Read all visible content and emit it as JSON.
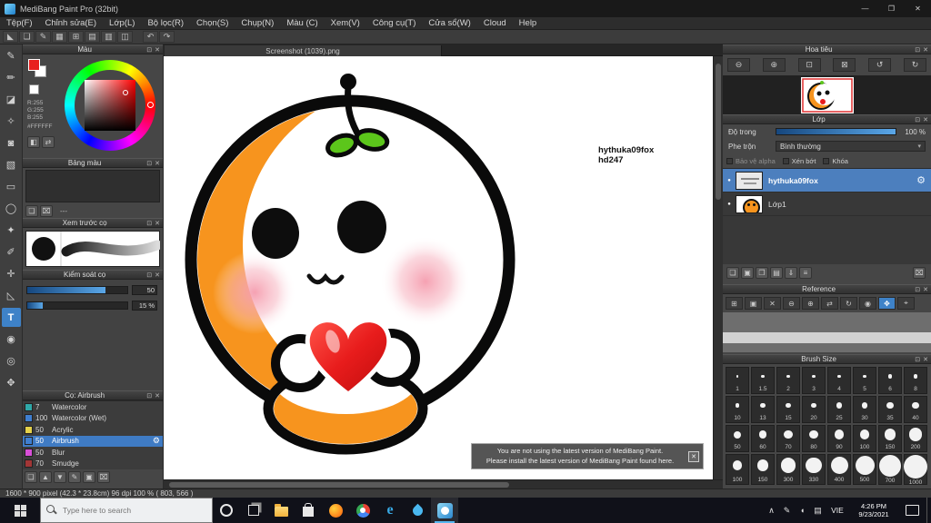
{
  "panel_controls": {
    "float": "⊡",
    "close": "✕"
  },
  "titlebar": {
    "title": "MediBang Paint Pro (32bit)",
    "minimize": "—",
    "restore": "❐",
    "close": "✕"
  },
  "menubar": {
    "items": [
      "Tệp(F)",
      "Chỉnh sửa(E)",
      "Lớp(L)",
      "Bộ lọc(R)",
      "Chọn(S)",
      "Chụp(N)",
      "Màu (C)",
      "Xem(V)",
      "Công cụ(T)",
      "Cửa sổ(W)",
      "Cloud",
      "Help"
    ]
  },
  "toolbar": {
    "icons": [
      {
        "name": "cursor-icon",
        "glyph": "◣"
      },
      {
        "name": "comment-icon",
        "glyph": "❏"
      },
      {
        "name": "pen-settings-icon",
        "glyph": "✎"
      },
      {
        "name": "material-icon",
        "glyph": "▦"
      },
      {
        "name": "grid-icon",
        "glyph": "⊞"
      },
      {
        "name": "guide-icon",
        "glyph": "▤"
      },
      {
        "name": "snap-icon",
        "glyph": "▥"
      },
      {
        "name": "ruler-icon",
        "glyph": "◫"
      }
    ],
    "undo": "↶",
    "redo": "↷"
  },
  "tools": {
    "items": [
      {
        "name": "pen-tool",
        "glyph": "✎"
      },
      {
        "name": "pencil-tool",
        "glyph": "✏"
      },
      {
        "name": "eraser-tool",
        "glyph": "◪"
      },
      {
        "name": "airbrush-tool",
        "glyph": "✧"
      },
      {
        "name": "fill-tool",
        "glyph": "◙"
      },
      {
        "name": "gradient-tool",
        "glyph": "▧"
      },
      {
        "name": "select-rect-tool",
        "glyph": "▭"
      },
      {
        "name": "lasso-tool",
        "glyph": "◯"
      },
      {
        "name": "magic-wand-tool",
        "glyph": "✦"
      },
      {
        "name": "select-pen-tool",
        "glyph": "✐"
      },
      {
        "name": "move-tool",
        "glyph": "✛"
      },
      {
        "name": "transform-tool",
        "glyph": "◺"
      },
      {
        "name": "text-tool",
        "glyph": "T",
        "active": true
      },
      {
        "name": "eyedropper-tool",
        "glyph": "◉"
      },
      {
        "name": "zoom-tool",
        "glyph": "◎"
      },
      {
        "name": "hand-tool",
        "glyph": "✥"
      }
    ]
  },
  "color_panel": {
    "title": "Màu",
    "fg_color": "#e8201f",
    "bg_color": "#ffffff",
    "rgb": [
      "R:255",
      "G:255",
      "B:255"
    ],
    "hex": "#FFFFFF",
    "buttons": [
      {
        "name": "add-swatch-icon",
        "glyph": "◧"
      },
      {
        "name": "swap-swatch-icon",
        "glyph": "⇄"
      }
    ]
  },
  "palette_panel": {
    "title": "Bảng màu",
    "icons": [
      {
        "name": "new-color-icon",
        "glyph": "❏"
      },
      {
        "name": "delete-color-icon",
        "glyph": "⌧"
      }
    ],
    "empty_label": "---"
  },
  "preview_panel": {
    "title": "Xem trước cọ"
  },
  "control_panel": {
    "title": "Kiểm soát cọ",
    "sliders": [
      {
        "name": "brush-size-slider",
        "value": "50",
        "fill": 78
      },
      {
        "name": "brush-opacity-slider",
        "value": "15 %",
        "fill": 15
      }
    ]
  },
  "brushes_panel": {
    "title": "Cọ: Airbrush",
    "items": [
      {
        "size": "7",
        "name": "Watercolor",
        "color": "#2fa8a8",
        "selected": false
      },
      {
        "size": "100",
        "name": "Watercolor (Wet)",
        "color": "#3f7fd0",
        "selected": false
      },
      {
        "size": "50",
        "name": "Acrylic",
        "color": "#e5d24a",
        "selected": false
      },
      {
        "size": "50",
        "name": "Airbrush",
        "color": "#3f7fd0",
        "selected": true
      },
      {
        "size": "50",
        "name": "Blur",
        "color": "#d84fd8",
        "selected": false
      },
      {
        "size": "70",
        "name": "Smudge",
        "color": "#a23636",
        "selected": false
      }
    ],
    "footer_icons": [
      {
        "name": "add-brush-icon",
        "glyph": "❏"
      },
      {
        "name": "brush-up-icon",
        "glyph": "▲"
      },
      {
        "name": "brush-down-icon",
        "glyph": "▼"
      },
      {
        "name": "edit-brush-icon",
        "glyph": "✎"
      },
      {
        "name": "brush-folder-icon",
        "glyph": "▣"
      },
      {
        "name": "delete-brush-icon",
        "glyph": "⌧"
      }
    ]
  },
  "canvas": {
    "tab": "Screenshot (1039).png",
    "watermark1": "hythuka09fox",
    "watermark2": "hd247",
    "notification": {
      "line1": "You are not using the latest version of MediBang Paint.",
      "line2": "Please install the latest version of MediBang Paint found here.",
      "close": "✕"
    }
  },
  "navigator_panel": {
    "title": "Hoa tiêu",
    "icons": [
      {
        "name": "zoom-out-icon",
        "glyph": "⊖"
      },
      {
        "name": "zoom-in-icon",
        "glyph": "⊕"
      },
      {
        "name": "zoom-100-icon",
        "glyph": "⊡"
      },
      {
        "name": "fit-window-icon",
        "glyph": "⊠"
      },
      {
        "name": "rotate-left-icon",
        "glyph": "↺"
      },
      {
        "name": "rotate-right-icon",
        "glyph": "↻"
      }
    ]
  },
  "layers_panel": {
    "title": "Lớp",
    "opacity_label": "Độ trong",
    "opacity_value": "100 %",
    "blend_label": "Phe trộn",
    "blend_value": "Bình thường",
    "caret": "▾",
    "checkboxes": [
      "Bảo vệ alpha",
      "Xén bớt",
      "Khóa"
    ],
    "layers": [
      {
        "name": "hythuka09fox",
        "selected": true
      },
      {
        "name": "Lớp1",
        "selected": false
      }
    ],
    "footer_icons": [
      {
        "name": "new-layer-icon",
        "glyph": "❏"
      },
      {
        "name": "new-folder-icon",
        "glyph": "▣"
      },
      {
        "name": "duplicate-layer-icon",
        "glyph": "❐"
      },
      {
        "name": "layer-folder-icon",
        "glyph": "▤"
      },
      {
        "name": "merge-down-icon",
        "glyph": "⇓"
      },
      {
        "name": "layer-menu-icon",
        "glyph": "≡"
      },
      {
        "name": "delete-layer-icon",
        "glyph": "⌧"
      }
    ]
  },
  "reference_panel": {
    "title": "Reference",
    "icons": [
      {
        "name": "ref-open-icon",
        "glyph": "⊞"
      },
      {
        "name": "ref-save-icon",
        "glyph": "▣"
      },
      {
        "name": "ref-close-icon",
        "glyph": "✕"
      },
      {
        "name": "ref-zoom-out-icon",
        "glyph": "⊖"
      },
      {
        "name": "ref-zoom-in-icon",
        "glyph": "⊕"
      },
      {
        "name": "ref-flip-icon",
        "glyph": "⇄"
      },
      {
        "name": "ref-rotate-icon",
        "glyph": "↻"
      },
      {
        "name": "ref-eyedropper-icon",
        "glyph": "◉"
      },
      {
        "name": "ref-hand-icon",
        "glyph": "✥",
        "active": true
      },
      {
        "name": "ref-crosshair-icon",
        "glyph": "⌖"
      }
    ]
  },
  "brush_size_panel": {
    "title": "Brush Size",
    "rows": [
      [
        "1",
        "1.5",
        "2",
        "3",
        "4",
        "5",
        "6",
        "8"
      ],
      [
        "10",
        "13",
        "15",
        "20",
        "25",
        "30",
        "35",
        "40"
      ],
      [
        "50",
        "60",
        "70",
        "80",
        "90",
        "100",
        "150",
        "200"
      ],
      [
        "100",
        "150",
        "300",
        "330",
        "400",
        "500",
        "700",
        "1000"
      ]
    ]
  },
  "statusbar": {
    "text": "1600 * 900 pixel   (42.3 * 23.8cm)   96 dpi  100 %  ( 803, 566 )"
  },
  "taskbar": {
    "search_placeholder": "Type here to search",
    "apps": [
      {
        "name": "taskbar-cortana-icon",
        "type": "ring"
      },
      {
        "name": "taskbar-taskview-icon",
        "type": "taskview"
      },
      {
        "name": "taskbar-explorer-icon",
        "type": "folder"
      },
      {
        "name": "taskbar-store-icon",
        "type": "bag"
      },
      {
        "name": "taskbar-firefox-icon",
        "type": "firefox"
      },
      {
        "name": "taskbar-chrome-icon",
        "type": "chrome"
      },
      {
        "name": "taskbar-edge-icon",
        "type": "edge"
      },
      {
        "name": "taskbar-paint-icon",
        "type": "drop"
      },
      {
        "name": "taskbar-medibang-icon",
        "type": "medibang",
        "active": true
      }
    ],
    "tray": [
      {
        "name": "tray-chevron-icon",
        "glyph": "∧"
      },
      {
        "name": "tray-pen-icon",
        "glyph": "✎"
      },
      {
        "name": "tray-speaker-icon",
        "glyph": "◖"
      },
      {
        "name": "tray-keyboard-icon",
        "glyph": "▤"
      }
    ],
    "language": "VIE",
    "time": "4:26 PM",
    "date": "9/23/2021"
  }
}
